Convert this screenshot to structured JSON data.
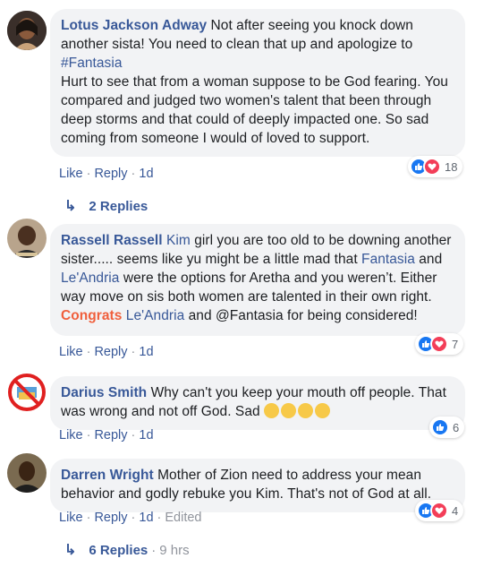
{
  "comments": [
    {
      "author": "Lotus Jackson Adway",
      "text_1": "Not after seeing you knock down another sista! You need to clean that up and apologize to ",
      "hashtag": "#Fantasia",
      "text_2": "Hurt to see that from a woman suppose to be God fearing. You compared and judged two women's talent that been through deep storms and that could of deeply impacted one. So sad coming from someone I would of loved to support.",
      "like": "Like",
      "reply": "Reply",
      "time": "1d",
      "reaction_count": "18",
      "replies": "2 Replies"
    },
    {
      "author": "Rassell Rassell",
      "mention_1": "Kim",
      "text_1": " girl you are too old to be downing another sister..... seems like yu might be a little mad that ",
      "mention_2": "Fantasia",
      "text_2": " and ",
      "mention_3": "Le'Andria",
      "text_3": " were the options for Aretha and you weren’t. Either way move on sis both women are talented in their own right. ",
      "congrats": "Congrats",
      "text_4": " ",
      "mention_4": "Le'Andria",
      "text_5": " and @Fantasia for being considered!",
      "like": "Like",
      "reply": "Reply",
      "time": "1d",
      "reaction_count": "7"
    },
    {
      "author": "Darius Smith",
      "text_1": "Why can't you keep your mouth off people. That was wrong and not off God. Sad",
      "like": "Like",
      "reply": "Reply",
      "time": "1d",
      "reaction_count": "6"
    },
    {
      "author": "Darren Wright",
      "text_1": "Mother of Zion need to address your mean behavior and godly rebuke you Kim. That's not of God at all.",
      "like": "Like",
      "reply": "Reply",
      "time": "1d",
      "edited": "Edited",
      "reaction_count": "4",
      "replies": "6 Replies",
      "replies_time": "9 hrs"
    }
  ],
  "colors": {
    "link": "#385898",
    "bubble": "#f2f3f5",
    "like": "#1877f2",
    "love": "#f33e58",
    "congrats": "#f05f3c"
  }
}
